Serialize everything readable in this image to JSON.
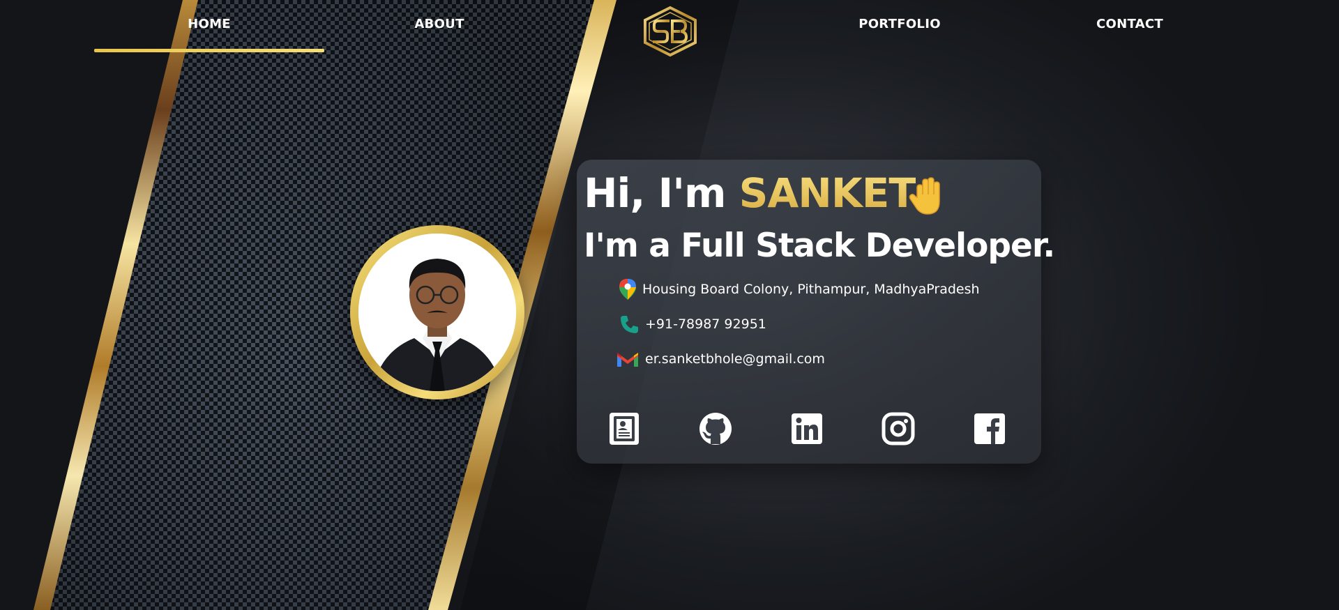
{
  "nav": {
    "home": "HOME",
    "about": "ABOUT",
    "portfolio": "PORTFOLIO",
    "contact": "CONTACT",
    "active": "HOME",
    "logo_icon": "sb-monogram-logo"
  },
  "hero": {
    "greeting_prefix": "Hi, I'm",
    "name": "SANKET",
    "wave_icon": "waving-hand-icon",
    "role": "I'm a Full Stack Developer.",
    "address": "Housing Board Colony, Pithampur, MadhyaPradesh",
    "phone": "+91-78987 92951",
    "email": "er.sanketbhole@gmail.com"
  },
  "socials": [
    {
      "name": "resume-icon"
    },
    {
      "name": "github-icon"
    },
    {
      "name": "linkedin-icon"
    },
    {
      "name": "instagram-icon"
    },
    {
      "name": "facebook-icon"
    }
  ],
  "colors": {
    "accent_gold": "#e9c64a",
    "name_gold": "#e3bb52",
    "text": "#ffffff",
    "card_bg": "#3a3e46"
  }
}
